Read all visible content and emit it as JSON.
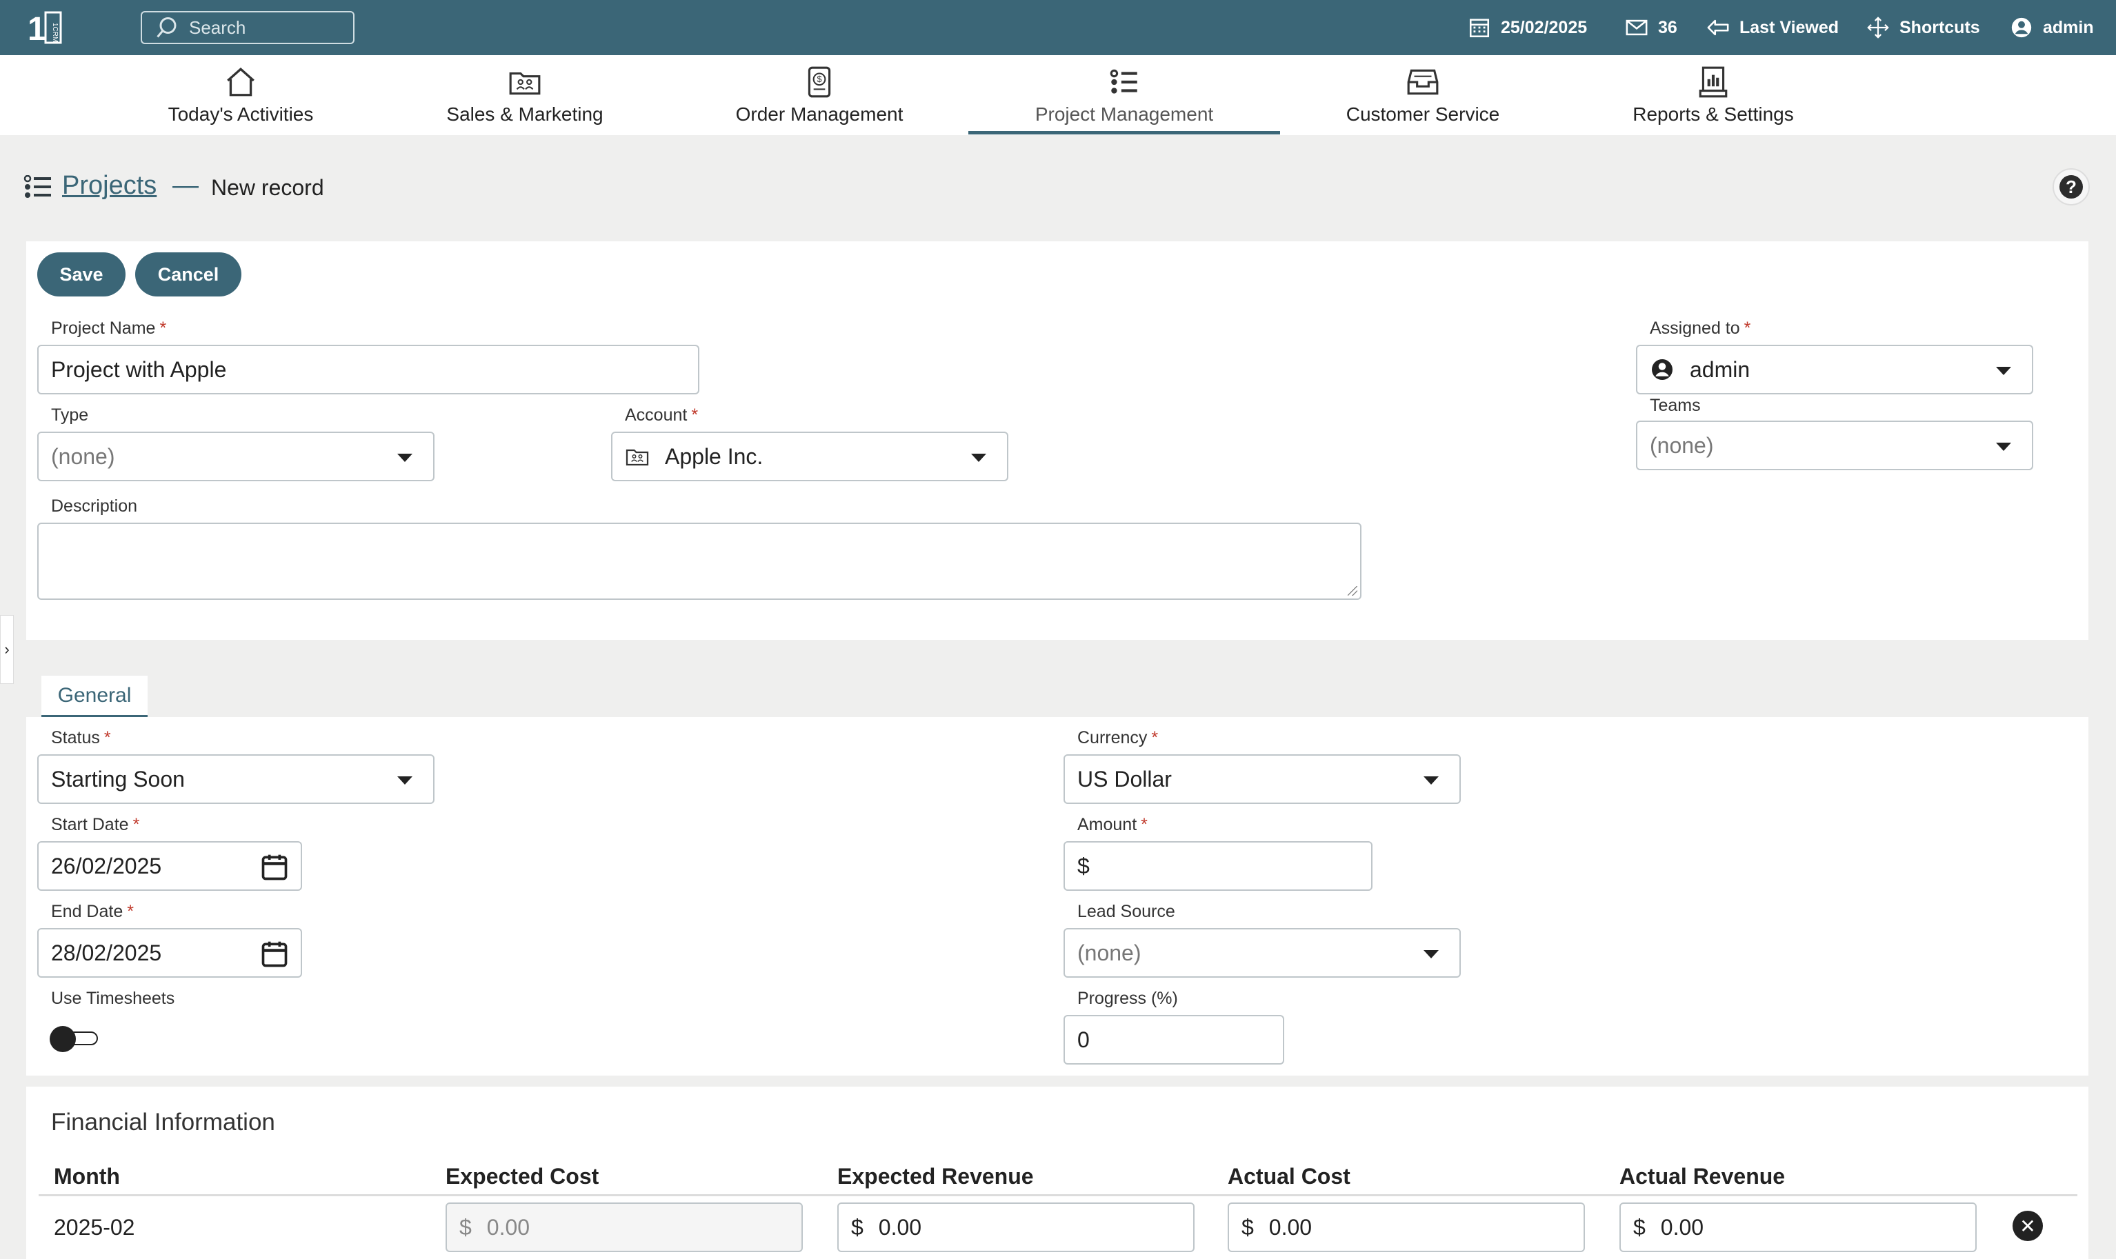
{
  "topbar": {
    "logo_text": "1CRM",
    "search_placeholder": "Search",
    "date": "25/02/2025",
    "mail_count": "36",
    "last_viewed": "Last Viewed",
    "shortcuts": "Shortcuts",
    "user": "admin"
  },
  "nav": {
    "tabs": [
      {
        "label": "Today's Activities",
        "icon": "house-icon"
      },
      {
        "label": "Sales & Marketing",
        "icon": "folder-people-icon"
      },
      {
        "label": "Order Management",
        "icon": "dollar-document-icon"
      },
      {
        "label": "Project Management",
        "icon": "list-icon",
        "active": true
      },
      {
        "label": "Customer Service",
        "icon": "inbox-icon"
      },
      {
        "label": "Reports & Settings",
        "icon": "report-icon"
      }
    ]
  },
  "header": {
    "module": "Projects",
    "separator": "—",
    "title": "New record"
  },
  "actions": {
    "save": "Save",
    "cancel": "Cancel"
  },
  "form": {
    "project_name": {
      "label": "Project Name",
      "value": "Project with Apple"
    },
    "type": {
      "label": "Type",
      "value": "(none)"
    },
    "account": {
      "label": "Account",
      "value": "Apple Inc."
    },
    "description": {
      "label": "Description",
      "value": ""
    },
    "assigned_to": {
      "label": "Assigned to",
      "value": "admin"
    },
    "teams": {
      "label": "Teams",
      "value": "(none)"
    }
  },
  "general_tab": "General",
  "general": {
    "status": {
      "label": "Status",
      "value": "Starting Soon"
    },
    "start_date": {
      "label": "Start Date",
      "value": "26/02/2025"
    },
    "end_date": {
      "label": "End Date",
      "value": "28/02/2025"
    },
    "use_timesheets": {
      "label": "Use Timesheets",
      "value": false
    },
    "currency": {
      "label": "Currency",
      "value": "US Dollar"
    },
    "amount": {
      "label": "Amount",
      "symbol": "$",
      "value": ""
    },
    "lead_source": {
      "label": "Lead Source",
      "value": "(none)"
    },
    "progress": {
      "label": "Progress (%)",
      "value": "0"
    }
  },
  "financial": {
    "title": "Financial Information",
    "columns": [
      "Month",
      "Expected Cost",
      "Expected Revenue",
      "Actual Cost",
      "Actual Revenue"
    ],
    "rows": [
      {
        "month": "2025-02",
        "expected_cost": "0.00",
        "expected_revenue": "0.00",
        "actual_cost": "0.00",
        "actual_revenue": "0.00"
      }
    ],
    "currency_symbol": "$",
    "remove_symbol": "✕"
  },
  "colors": {
    "accent": "#3b6677",
    "required": "#c0392b",
    "background": "#efefee"
  }
}
